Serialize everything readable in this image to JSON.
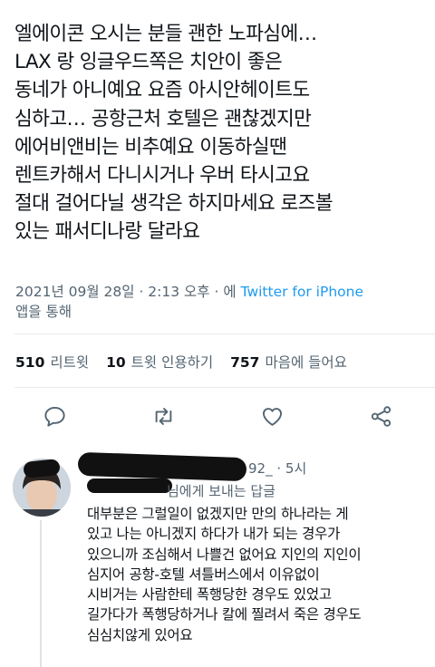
{
  "tweet": {
    "lines": [
      "엘에이콘 오시는 분들 괜한 노파심에…",
      "LAX 랑 잉글우드쪽은 치안이 좋은",
      "동네가 아니예요 요즘 아시안헤이트도",
      "심하고… 공항근처 호텔은 괜찮겠지만",
      "에어비앤비는 비추예요 이동하실땐",
      "렌트카해서 다니시거나 우버 타시고요",
      "절대 걸어다닐 생각은 하지마세요 로즈볼",
      "있는 패서디나랑 달라요"
    ],
    "timestamp": "2021년 09월 28일 · 2:13 오후 · 에",
    "source": "Twitter for iPhone",
    "source_suffix": "앱을 통해"
  },
  "stats": {
    "retweets_count": "510",
    "retweets_label": "리트윗",
    "quotes_count": "10",
    "quotes_label": "트윗 인용하기",
    "likes_count": "757",
    "likes_label": "마음에 들어요"
  },
  "actions": [
    {
      "icon": "reply-icon"
    },
    {
      "icon": "retweet-icon"
    },
    {
      "icon": "like-icon"
    },
    {
      "icon": "share-icon"
    }
  ],
  "reply": {
    "handle_tail": "92_",
    "time": "· 5시",
    "reply_to_suffix": "님에게 보내는 답글",
    "lines": [
      "대부분은 그럴일이 없겠지만 만의 하나라는 게",
      "있고 나는 아니겠지 하다가 내가 되는 경우가",
      "있으니까 조심해서 나쁠건 없어요 지인의 지인이",
      "심지어 공항-호텔 셔틀버스에서 이유없이",
      "시비거는 사람한테 폭행당한 경우도 있었고",
      "길가다가 폭행당하거나 칼에 찔려서 죽은 경우도",
      "심심치않게 있어요"
    ]
  },
  "colors": {
    "text": "#0f1419",
    "secondary": "#536471",
    "accent": "#1d9bf0",
    "divider": "#e6e9eb"
  }
}
